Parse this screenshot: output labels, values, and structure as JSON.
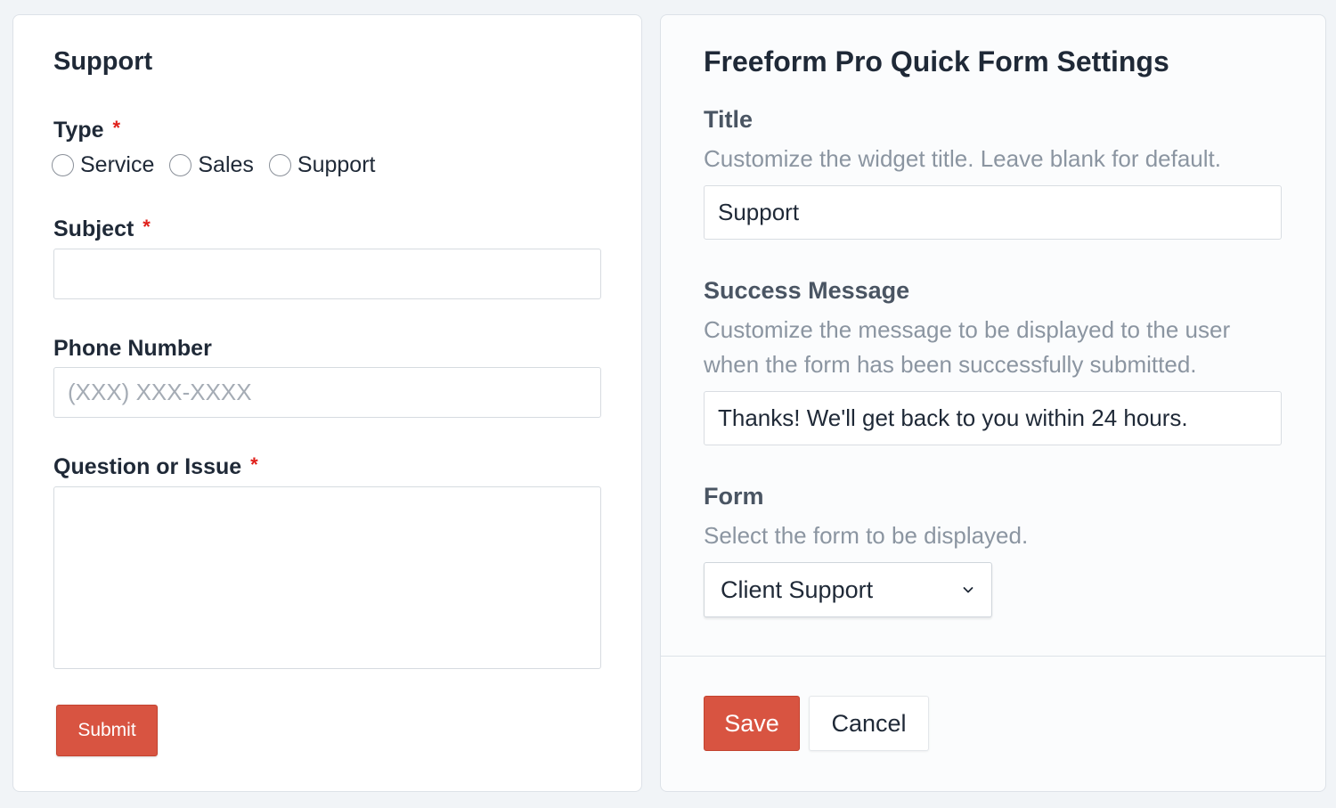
{
  "form_widget": {
    "title": "Support",
    "type": {
      "label": "Type",
      "required_mark": "*",
      "options": [
        "Service",
        "Sales",
        "Support"
      ]
    },
    "subject": {
      "label": "Subject",
      "required_mark": "*",
      "value": ""
    },
    "phone": {
      "label": "Phone Number",
      "placeholder": "(XXX) XXX-XXXX",
      "value": ""
    },
    "question": {
      "label": "Question or Issue",
      "required_mark": "*",
      "value": ""
    },
    "submit_label": "Submit"
  },
  "settings": {
    "heading": "Freeform Pro Quick Form Settings",
    "title": {
      "label": "Title",
      "description": "Customize the widget title. Leave blank for default.",
      "value": "Support"
    },
    "success": {
      "label": "Success Message",
      "description_line1": "Customize the message to be displayed to the user",
      "description_line2": "when the form has been successfully submitted.",
      "value": "Thanks! We'll get back to you within 24 hours."
    },
    "form": {
      "label": "Form",
      "description": "Select the form to be displayed.",
      "selected": "Client Support"
    },
    "save_label": "Save",
    "cancel_label": "Cancel"
  },
  "colors": {
    "accent": "#d85441",
    "required": "#e0201b",
    "muted_text": "#8b95a1",
    "background": "#f1f4f7"
  },
  "icons": {
    "select_chevron": "chevron-down-icon",
    "radio": "radio-unchecked-icon"
  }
}
